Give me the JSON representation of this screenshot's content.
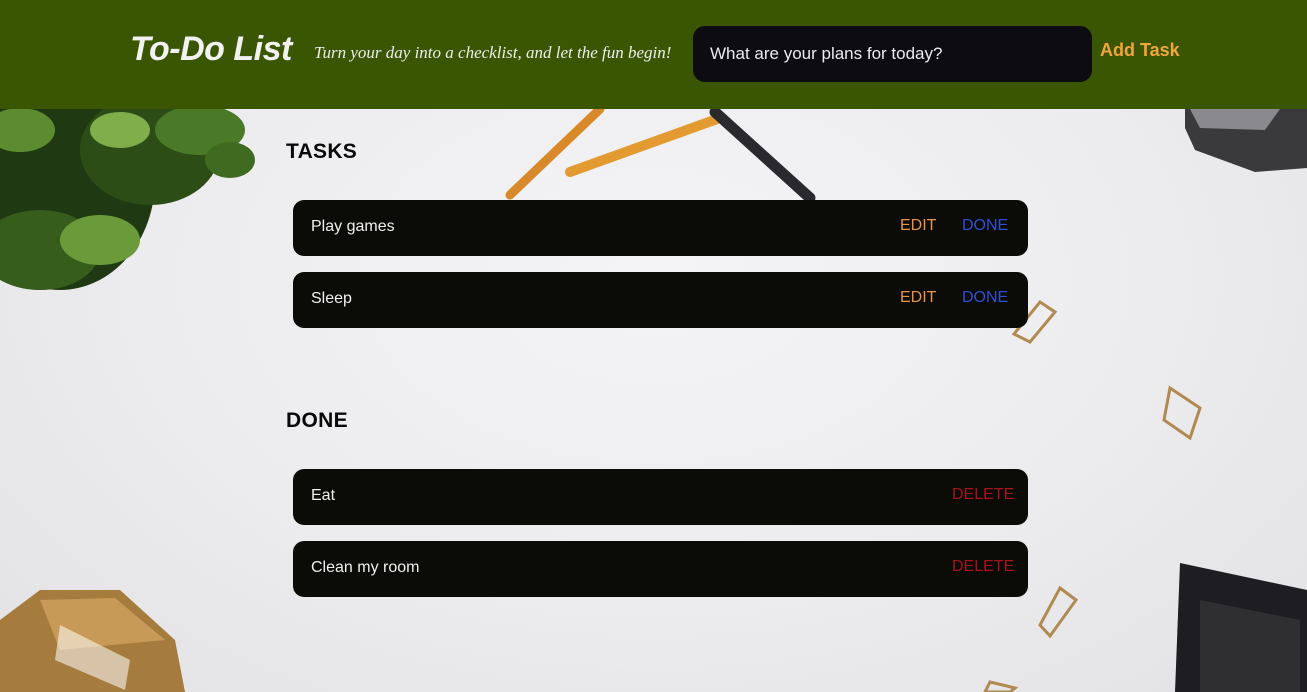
{
  "header": {
    "title": "To-Do List",
    "tagline": "Turn your day into a checklist, and let the fun begin!",
    "input_placeholder": "What are your plans for today?",
    "add_button_label": "Add Task"
  },
  "tasks_section": {
    "heading": "TASKS",
    "items": [
      {
        "label": "Play games",
        "edit_label": "EDIT",
        "done_label": "DONE"
      },
      {
        "label": "Sleep",
        "edit_label": "EDIT",
        "done_label": "DONE"
      }
    ]
  },
  "done_section": {
    "heading": "DONE",
    "items": [
      {
        "label": "Eat",
        "delete_label": "DELETE"
      },
      {
        "label": "Clean my room",
        "delete_label": "DELETE"
      }
    ]
  },
  "colors": {
    "header_bg": "#3a5603",
    "add_button": "#f2a53a",
    "edit": "#e8944a",
    "done": "#2f4fd6",
    "delete": "#a8141e",
    "row_bg": "#0b0b07"
  }
}
